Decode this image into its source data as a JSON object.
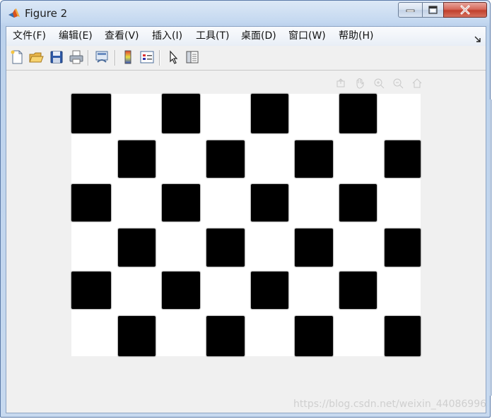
{
  "window": {
    "title": "Figure 2",
    "buttons": [
      "minimize",
      "maximize",
      "close"
    ]
  },
  "menubar": {
    "items": [
      {
        "label": "文件(F)"
      },
      {
        "label": "编辑(E)"
      },
      {
        "label": "查看(V)"
      },
      {
        "label": "插入(I)"
      },
      {
        "label": "工具(T)"
      },
      {
        "label": "桌面(D)"
      },
      {
        "label": "窗口(W)"
      },
      {
        "label": "帮助(H)"
      }
    ]
  },
  "toolbar": {
    "icons": [
      "new-figure-icon",
      "open-file-icon",
      "save-icon",
      "print-icon",
      "link-plot-icon",
      "colorbar-icon",
      "legend-icon",
      "edit-plot-arrow-icon",
      "property-inspector-icon"
    ]
  },
  "axes_toolbar": {
    "icons": [
      "export-icon",
      "pan-icon",
      "zoom-in-icon",
      "zoom-out-icon",
      "home-icon"
    ]
  },
  "image": {
    "description_colors": {
      "dark": "#000000",
      "light": "#ffffff"
    },
    "rows": 6,
    "cols": 8
  },
  "watermark": {
    "text": "https://blog.csdn.net/weixin_44086996"
  },
  "colors": {
    "title_bar": "#c4d8f0",
    "close_button": "#c1402c",
    "client_bg": "#f0f0f0"
  }
}
